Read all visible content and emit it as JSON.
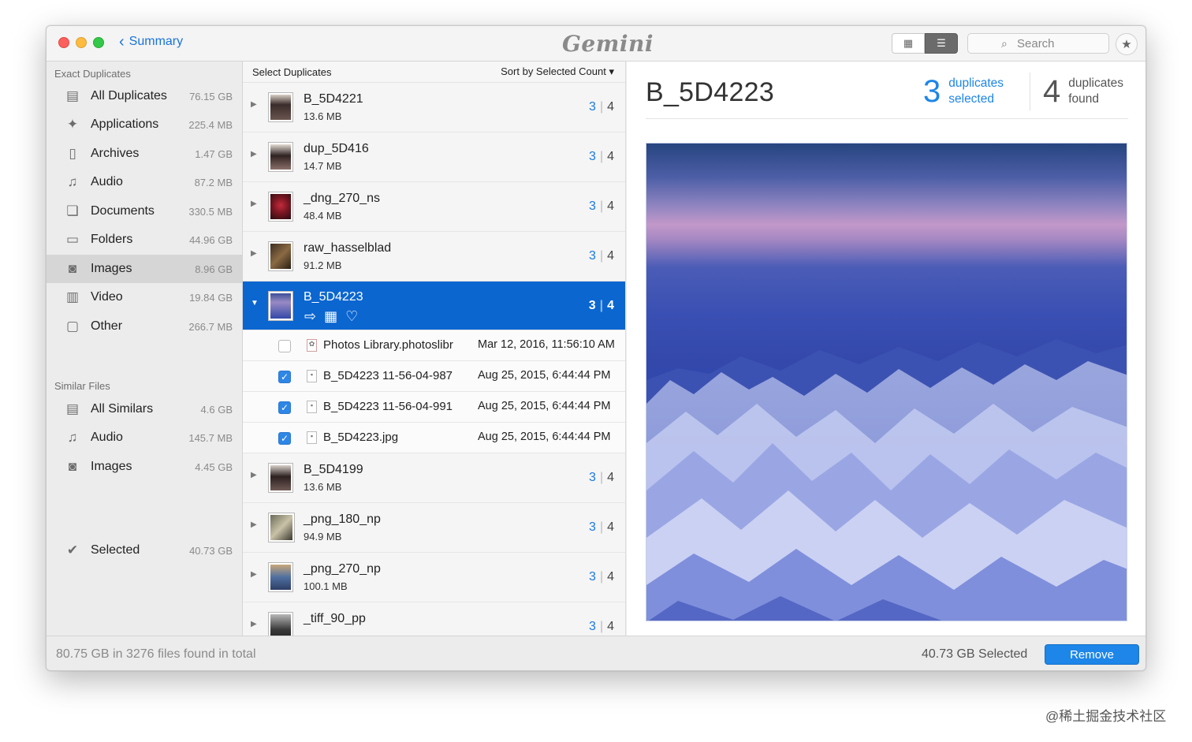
{
  "titlebar": {
    "back_label": "Summary",
    "app_logo": "Gemini",
    "search_placeholder": "Search"
  },
  "sidebar": {
    "exact_header": "Exact Duplicates",
    "exact_items": [
      {
        "label": "All Duplicates",
        "size": "76.15 GB",
        "icon": "all-duplicates-icon"
      },
      {
        "label": "Applications",
        "size": "225.4 MB",
        "icon": "applications-icon"
      },
      {
        "label": "Archives",
        "size": "1.47 GB",
        "icon": "archive-icon"
      },
      {
        "label": "Audio",
        "size": "87.2 MB",
        "icon": "music-note-icon"
      },
      {
        "label": "Documents",
        "size": "330.5 MB",
        "icon": "documents-icon"
      },
      {
        "label": "Folders",
        "size": "44.96 GB",
        "icon": "folder-icon"
      },
      {
        "label": "Images",
        "size": "8.96 GB",
        "icon": "camera-icon"
      },
      {
        "label": "Video",
        "size": "19.84 GB",
        "icon": "film-icon"
      },
      {
        "label": "Other",
        "size": "266.7 MB",
        "icon": "file-icon"
      }
    ],
    "similar_header": "Similar Files",
    "similar_items": [
      {
        "label": "All Similars",
        "size": "4.6 GB",
        "icon": "all-similars-icon"
      },
      {
        "label": "Audio",
        "size": "145.7 MB",
        "icon": "music-note-icon"
      },
      {
        "label": "Images",
        "size": "4.45 GB",
        "icon": "camera-icon"
      }
    ],
    "selected": {
      "label": "Selected",
      "size": "40.73 GB",
      "icon": "check-circle-icon"
    }
  },
  "list": {
    "header_left": "Select Duplicates",
    "header_right": "Sort by Selected Count",
    "groups": [
      {
        "name": "B_5D4221",
        "size": "13.6 MB",
        "selected": "3",
        "total": "4"
      },
      {
        "name": "dup_5D416",
        "size": "14.7 MB",
        "selected": "3",
        "total": "4"
      },
      {
        "name": "_dng_270_ns",
        "size": "48.4 MB",
        "selected": "3",
        "total": "4"
      },
      {
        "name": "raw_hasselblad",
        "size": "91.2 MB",
        "selected": "3",
        "total": "4"
      },
      {
        "name": "B_5D4223",
        "size": "",
        "selected": "3",
        "total": "4"
      },
      {
        "name": "B_5D4199",
        "size": "13.6 MB",
        "selected": "3",
        "total": "4"
      },
      {
        "name": "_png_180_np",
        "size": "94.9 MB",
        "selected": "3",
        "total": "4"
      },
      {
        "name": "_png_270_np",
        "size": "100.1 MB",
        "selected": "3",
        "total": "4"
      },
      {
        "name": "_tiff_90_pp",
        "size": "",
        "selected": "3",
        "total": "4"
      }
    ],
    "files": [
      {
        "name": "Photos Library.photoslibr",
        "date": "Mar 12, 2016, 11:56:10 AM",
        "checked": false
      },
      {
        "name": "B_5D4223 11-56-04-987",
        "date": "Aug 25, 2015, 6:44:44 PM",
        "checked": true
      },
      {
        "name": "B_5D4223 11-56-04-991",
        "date": "Aug 25, 2015, 6:44:44 PM",
        "checked": true
      },
      {
        "name": "B_5D4223.jpg",
        "date": "Aug 25, 2015, 6:44:44 PM",
        "checked": true
      }
    ]
  },
  "detail": {
    "title": "B_5D4223",
    "selected_count": "3",
    "selected_line1": "duplicates",
    "selected_line2": "selected",
    "found_count": "4",
    "found_line1": "duplicates",
    "found_line2": "found"
  },
  "footer": {
    "total": "80.75 GB in 3276 files found in total",
    "selected": "40.73 GB Selected",
    "remove_label": "Remove"
  },
  "watermark": "@稀土掘金技术社区",
  "colors": {
    "accent": "#1d86e8",
    "active_row": "#0b66d0"
  }
}
